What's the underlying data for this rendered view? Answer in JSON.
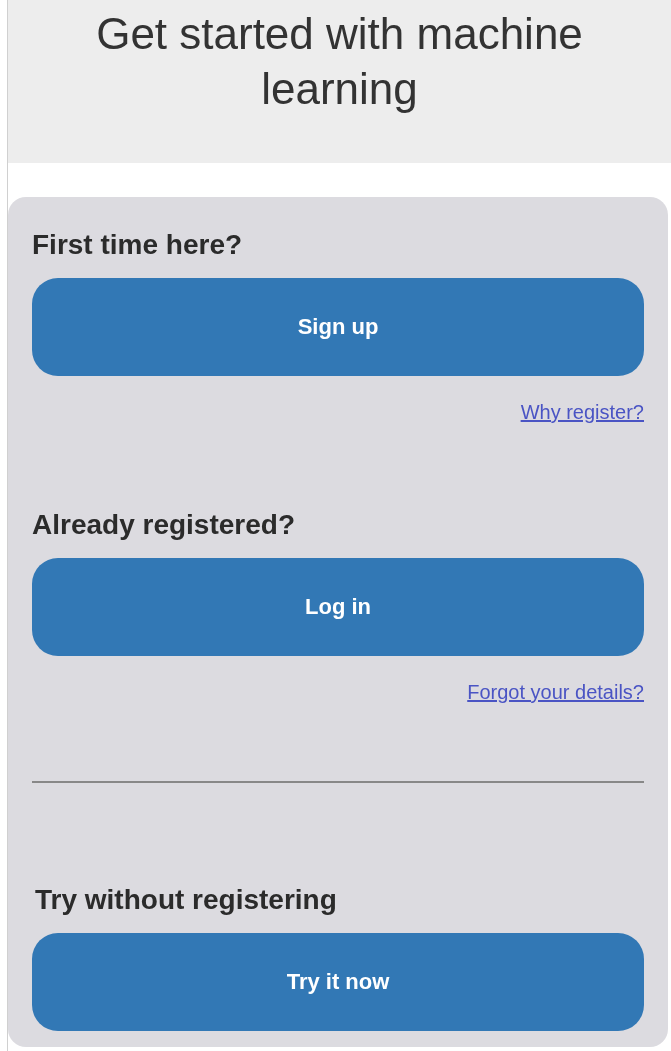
{
  "header": {
    "title": "Get started with machine learning"
  },
  "panel": {
    "items": [
      {
        "kind": "section",
        "heading": "First time here?",
        "button": "Sign up",
        "link": "Why register?"
      },
      {
        "kind": "section",
        "heading": "Already registered?",
        "button": "Log in",
        "link": "Forgot your details?"
      },
      {
        "kind": "divider"
      },
      {
        "kind": "section",
        "heading": "Try without registering",
        "button": "Try it now"
      }
    ]
  }
}
